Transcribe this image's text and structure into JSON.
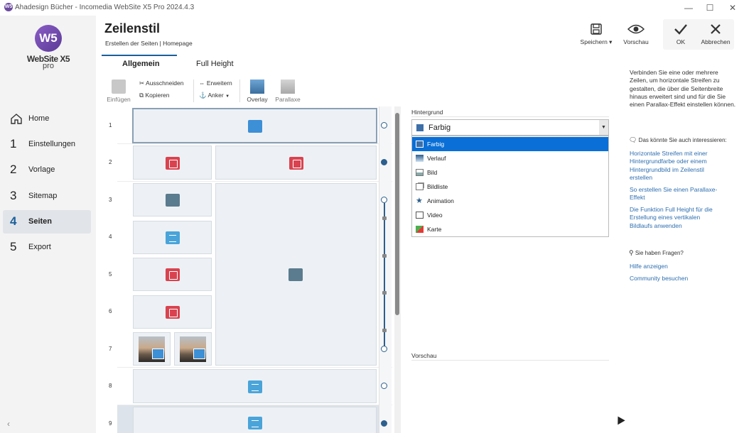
{
  "window": {
    "title": "Ahadesign Bücher - Incomedia WebSite X5 Pro 2024.4.3",
    "app_badge": "W5",
    "controls": [
      "—",
      "☐",
      "✕"
    ]
  },
  "logo": {
    "mark": "W5",
    "text": "WebSite X5",
    "sub": "pro"
  },
  "sidebar": {
    "items": [
      {
        "num": "",
        "label": "Home"
      },
      {
        "num": "1",
        "label": "Einstellungen"
      },
      {
        "num": "2",
        "label": "Vorlage"
      },
      {
        "num": "3",
        "label": "Sitemap"
      },
      {
        "num": "4",
        "label": "Seiten"
      },
      {
        "num": "5",
        "label": "Export"
      }
    ],
    "active_index": 4,
    "collapse": "‹"
  },
  "header": {
    "title": "Zeilenstil",
    "breadcrumb": "Erstellen der Seiten | Homepage",
    "save": "Speichern ▾",
    "preview": "Vorschau",
    "ok": "OK",
    "cancel": "Abbrechen"
  },
  "tabs": [
    {
      "label": "Allgemein",
      "active": true
    },
    {
      "label": "Full Height",
      "active": false
    }
  ],
  "toolbar": {
    "paste": "Einfügen",
    "cut": "Ausschneiden",
    "copy": "Kopieren",
    "expand": "Erweitern",
    "anchor": "Anker",
    "overlay": "Overlay",
    "parallax": "Parallaxe"
  },
  "grid": {
    "rows": [
      "1",
      "2",
      "3",
      "4",
      "5",
      "6",
      "7",
      "8",
      "9"
    ]
  },
  "properties": {
    "background_label": "Hintergrund",
    "background_value": "Farbig",
    "options": [
      "Farbig",
      "Verlauf",
      "Bild",
      "Bildliste",
      "Animation",
      "Video",
      "Karte"
    ],
    "selected_option": 0,
    "preview_label": "Vorschau"
  },
  "help": {
    "intro": "Verbinden Sie eine oder mehrere Zeilen, um horizontale Streifen zu gestalten, die  über die Seitenbreite hinaus erweitert sind und für die Sie einen Parallax-Effekt einstellen können.",
    "interest_head": "Das könnte Sie auch interessieren:",
    "links": [
      "Horizontale Streifen mit einer Hintergrundfarbe oder einem Hintergrundbild  im Zeilenstil erstellen",
      "So erstellen Sie einen Parallaxe-Effekt",
      "Die Funktion Full Height für die Erstellung eines vertikalen Bildlaufs anwenden"
    ],
    "questions_head": "Sie haben Fragen?",
    "help_link": "Hilfe anzeigen",
    "community_link": "Community besuchen"
  },
  "colors": {
    "accent": "#1a5f9c",
    "selection": "#0a6fd6",
    "link": "#2e6fb0"
  }
}
